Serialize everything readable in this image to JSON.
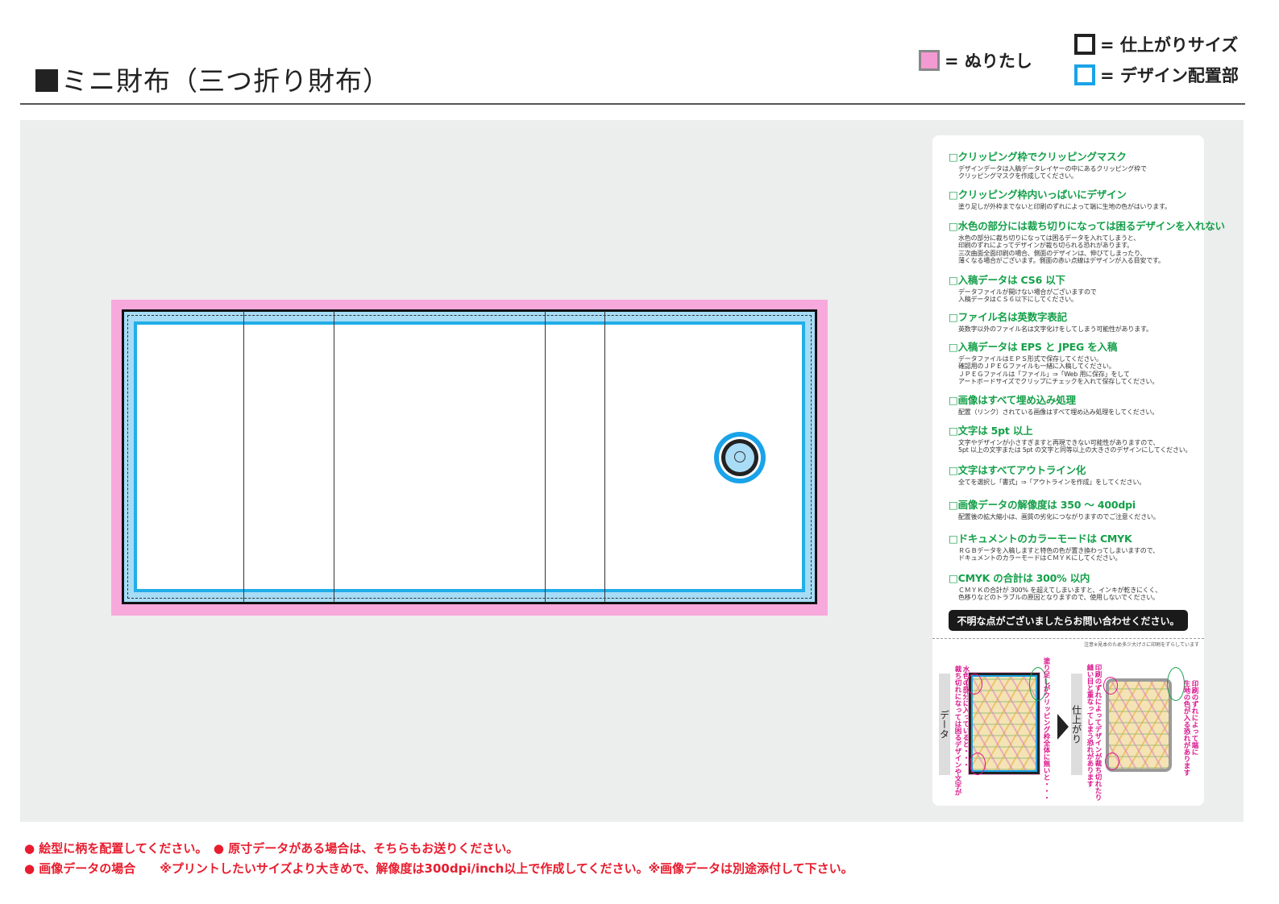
{
  "header": {
    "title": "ミニ財布（三つ折り財布）"
  },
  "legend": {
    "bleed": "= ぬりたし",
    "finish": "= 仕上がりサイズ",
    "design": "= デザイン配置部",
    "colors": {
      "bleed": "#f49ad2",
      "finish": "#222222",
      "design": "#1aa3e8"
    }
  },
  "checklist": [
    {
      "title": "□クリッピング枠でクリッピングマスク",
      "desc": "デザインデータは入稿データレイヤーの中にあるクリッピング枠で\nクリッピングマスクを作成してください。"
    },
    {
      "title": "□クリッピング枠内いっぱいにデザイン",
      "desc": "塗り足しが外枠までないと印刷のずれによって端に生地の色がはいります。"
    },
    {
      "title": "□水色の部分には裁ち切りになっては困るデザインを入れない",
      "desc": "水色の部分に裁ち切りになっては困るデータを入れてしまうと、\n印刷のずれによってデザインが裁ち切られる恐れがあります。\n三次曲面全面印刷の場合、側面のデザインは、伸びてしまったり、\n薄くなる場合がございます。側面の赤い点線はデザインが入る目安です。"
    },
    {
      "title": "□入稿データは CS6 以下",
      "desc": "データファイルが開けない場合がございますので\n入稿データはＣＳ６以下にしてください。"
    },
    {
      "title": "□ファイル名は英数字表記",
      "desc": "英数字以外のファイル名は文字化けをしてしまう可能性があります。"
    },
    {
      "title": "□入稿データは EPS と JPEG を入稿",
      "desc": "データファイルはＥＰＳ形式で保存してください。\n確認用のＪＰＥＧファイルも一緒に入稿してください。\nＪＰＥＧファイルは「ファイル」⇒「Web 用に保存」をして\nアートボードサイズでクリップにチェックを入れて保存してください。"
    },
    {
      "title": "□画像はすべて埋め込み処理",
      "desc": "配置（リンク）されている画像はすべて埋め込み処理をしてください。"
    },
    {
      "title": "□文字は 5pt 以上",
      "desc": "文字やデザインが小さすぎますと再現できない可能性がありますので、\n5pt 以上の文字または 5pt の文字と同等以上の大きさのデザインにしてください。"
    },
    {
      "title": "□文字はすべてアウトライン化",
      "desc": "全てを選択し「書式」⇒「アウトラインを作成」をしてください。"
    },
    {
      "title": "□画像データの解像度は 350 〜 400dpi",
      "desc": "配置後の拡大縮小は、画質の劣化につながりますのでご注意ください。"
    },
    {
      "title": "□ドキュメントのカラーモードは CMYK",
      "desc": "ＲＧＢデータを入稿しますと特色の色が置き換わってしまいますので、\nドキュメントのカラーモードはＣＭＹＫにしてください。"
    },
    {
      "title": "□CMYK の合計は 300% 以内",
      "desc": "ＣＭＹＫの合計が 300% を超えてしまいますと、インキが乾きにくく、\n色移りなどのトラブルの原因となりますので、使用しないでください。"
    }
  ],
  "contact": "不明な点がございましたらお問い合わせください。",
  "sample": {
    "note": "注意※見本のため多少大げさに印刷をずらしています",
    "data_label": "データ",
    "finish_label": "仕上がり",
    "warn_cut": "水色の部分に入っていると・・・\n裁ち切れになっては困るデザインや文字が",
    "warn_bleed": "塗り足しがクリッピング枠全体に無いと・・・",
    "warn_cut_result": "印刷のずれによってデザインが裁ち切れたり\n縫い目と重なってしまう恐れがあります",
    "warn_bleed_result": "印刷のずれによって端に\n生地の色が入る恐れがあります"
  },
  "footer": {
    "line1": "● 絵型に柄を配置してください。　● 原寸データがある場合は、そちらもお送りください。",
    "line2": "● 画像データの場合　　※プリントしたいサイズより大きめで、解像度は300dpi/inch以上で作成してください。※画像データは別途添付して下さい。"
  }
}
